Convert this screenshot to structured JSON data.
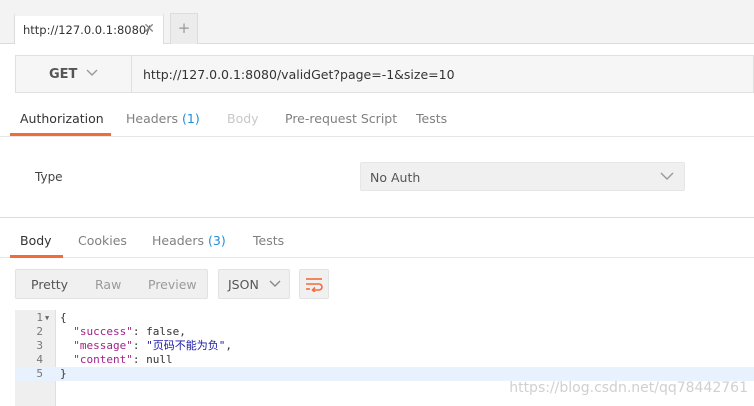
{
  "tabs": [
    {
      "label": "http://127.0.0.1:8080/",
      "close": "✕"
    }
  ],
  "add_tab_label": "+",
  "request": {
    "method": "GET",
    "url": "http://127.0.0.1:8080/validGet?page=-1&size=10"
  },
  "request_tabs": {
    "authorization": "Authorization",
    "headers": "Headers",
    "headers_count": "(1)",
    "body": "Body",
    "prerequest": "Pre-request Script",
    "tests": "Tests"
  },
  "auth": {
    "type_label": "Type",
    "selected": "No Auth"
  },
  "response_tabs": {
    "body": "Body",
    "cookies": "Cookies",
    "headers": "Headers",
    "headers_count": "(3)",
    "tests": "Tests"
  },
  "response_toolbar": {
    "pretty": "Pretty",
    "raw": "Raw",
    "preview": "Preview",
    "format": "JSON"
  },
  "response_body": {
    "line_numbers": [
      "1",
      "2",
      "3",
      "4",
      "5"
    ],
    "open_brace": "{",
    "close_brace": "}",
    "success_key": "\"success\"",
    "success_value": "false",
    "message_key": "\"message\"",
    "message_value": "\"页码不能为负\"",
    "content_key": "\"content\"",
    "content_value": "null"
  },
  "watermark": "https://blog.csdn.net/qq78442761",
  "colors": {
    "accent": "#f26b3a",
    "count": "#1f8fd6"
  }
}
